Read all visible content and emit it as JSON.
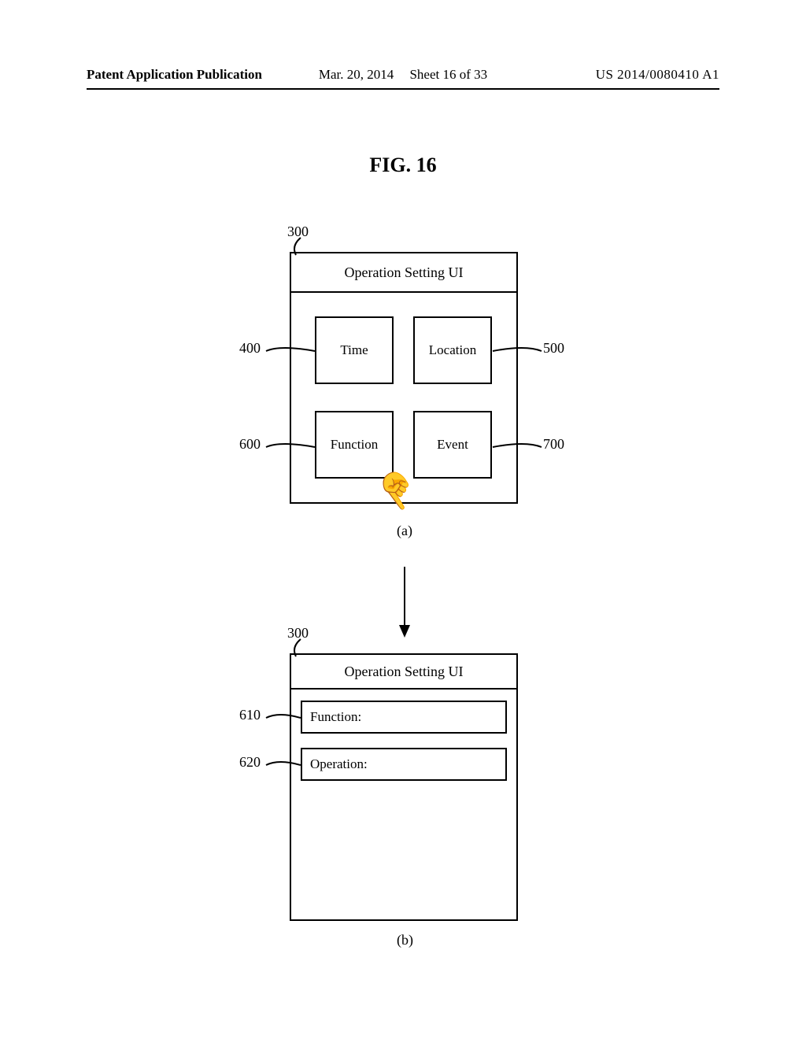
{
  "header": {
    "publication_label": "Patent Application Publication",
    "date": "Mar. 20, 2014",
    "sheet": "Sheet 16 of 33",
    "pub_num": "US 2014/0080410 A1"
  },
  "figure": {
    "title": "FIG. 16",
    "sub_a": "(a)",
    "sub_b": "(b)"
  },
  "panelA": {
    "ref": "300",
    "title": "Operation Setting UI",
    "buttons": {
      "time": {
        "label": "Time",
        "ref": "400"
      },
      "location": {
        "label": "Location",
        "ref": "500"
      },
      "function": {
        "label": "Function",
        "ref": "600"
      },
      "event": {
        "label": "Event",
        "ref": "700"
      }
    }
  },
  "panelB": {
    "ref": "300",
    "title": "Operation Setting UI",
    "fields": {
      "function": {
        "label": "Function:",
        "ref": "610"
      },
      "operation": {
        "label": "Operation:",
        "ref": "620"
      }
    }
  }
}
